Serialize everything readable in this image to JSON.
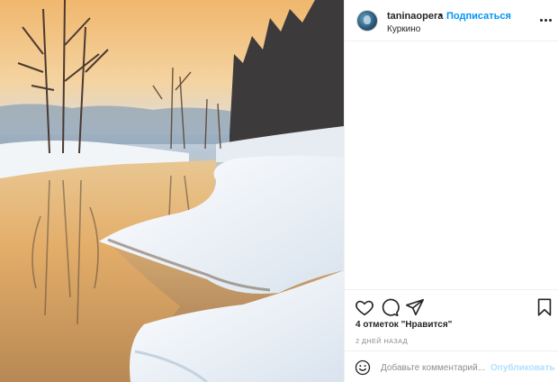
{
  "post": {
    "image": {
      "description_icon": "winter-river-landscape"
    },
    "header": {
      "username": "taninaopera",
      "separator": "•",
      "follow_label": "Подписаться",
      "location": "Куркино",
      "more_icon": "more-horizontal-icon"
    },
    "actions": {
      "like_icon": "heart-icon",
      "comment_icon": "comment-icon",
      "share_icon": "send-icon",
      "save_icon": "bookmark-icon"
    },
    "likes_text": "4 отметок \"Нравится\"",
    "timestamp": "2 ДНЕЙ НАЗАД",
    "comment": {
      "placeholder": "Добавьте комментарий...",
      "publish_label": "Опубликовать",
      "emoji_icon": "smiley-icon"
    }
  },
  "colors": {
    "accent": "#0095f6",
    "publish_disabled": "#b2dffc",
    "border": "#efefef",
    "muted": "#8e8e8e"
  }
}
